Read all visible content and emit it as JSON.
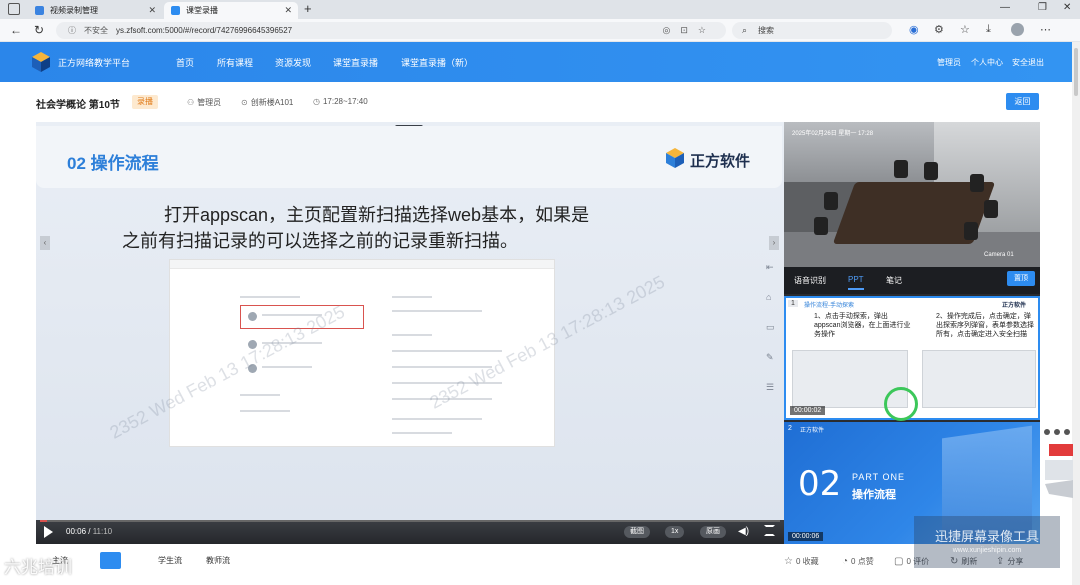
{
  "browser": {
    "tabs": [
      {
        "title": "视频录制管理",
        "active": false
      },
      {
        "title": "课堂录播",
        "active": true
      }
    ],
    "address": {
      "warning": "不安全",
      "url": "ys.zfsoft.com:5000/#/record/74276996645396527"
    },
    "search_placeholder": "搜索"
  },
  "app": {
    "brand": "正方网络教学平台",
    "nav": [
      "首页",
      "所有课程",
      "资源发现",
      "课堂直录播",
      "课堂直录播（新）"
    ],
    "user": "管理员",
    "personal_center": "个人中心",
    "logout": "安全退出"
  },
  "course": {
    "title": "社会学概论 第10节",
    "badge": "录播",
    "teacher": "管理员",
    "location": "创新楼A101",
    "time_range": "17:28~17:40",
    "back_label": "返回"
  },
  "slide": {
    "section_title": "02 操作流程",
    "brand": "正方软件",
    "text_line1": "打开appscan，主页配置新扫描选择web基本，如果是",
    "text_line2": "之前有扫描记录的可以选择之前的记录重新扫描。",
    "watermark": "2352 Wed Feb 13 17:28:13 2025"
  },
  "player": {
    "current_time": "00:06",
    "total_time": "11:10",
    "progress": 0.009,
    "screenshot_label": "截图",
    "speed_label": "1x",
    "quality_label": "原画"
  },
  "camera": {
    "timestamp": "2025年02月26日 星期一 17:28",
    "cam_label": "Camera 01"
  },
  "right_tabs": {
    "items": [
      "语音识别",
      "PPT",
      "笔记"
    ],
    "active_index": 1,
    "sync_label": "置顶"
  },
  "thumbs": [
    {
      "index": "1",
      "title": "操作流程-手动探索",
      "brand": "正方软件",
      "col1": "1、点击手动探索，弹出appscan浏览器，在上面进行业务操作",
      "col2": "2、操作完成后，点击确定，弹出探索序列弹窗，表单参数选择所有，点击确定进入安全扫描",
      "duration": "00:00:02"
    },
    {
      "index": "2",
      "brand": "正方软件",
      "big": "02",
      "part": "PART ONE",
      "heading": "操作流程",
      "duration": "00:00:06"
    }
  ],
  "bottom": {
    "streams": [
      "主流",
      "学生流",
      "教师流"
    ],
    "active_stream": 0,
    "actions": [
      {
        "icon": "star-icon",
        "label": "0 收藏"
      },
      {
        "icon": "thumb-up-icon",
        "label": "0 点赞"
      },
      {
        "icon": "comment-icon",
        "label": "0 评价"
      },
      {
        "icon": "refresh-icon",
        "label": "刷新"
      },
      {
        "icon": "share-icon",
        "label": "分享"
      }
    ]
  },
  "overlay": {
    "recorder_brand": "迅捷屏幕录像工具",
    "recorder_url": "www.xunjieshipin.com",
    "corner_brand": "六兆培训"
  }
}
